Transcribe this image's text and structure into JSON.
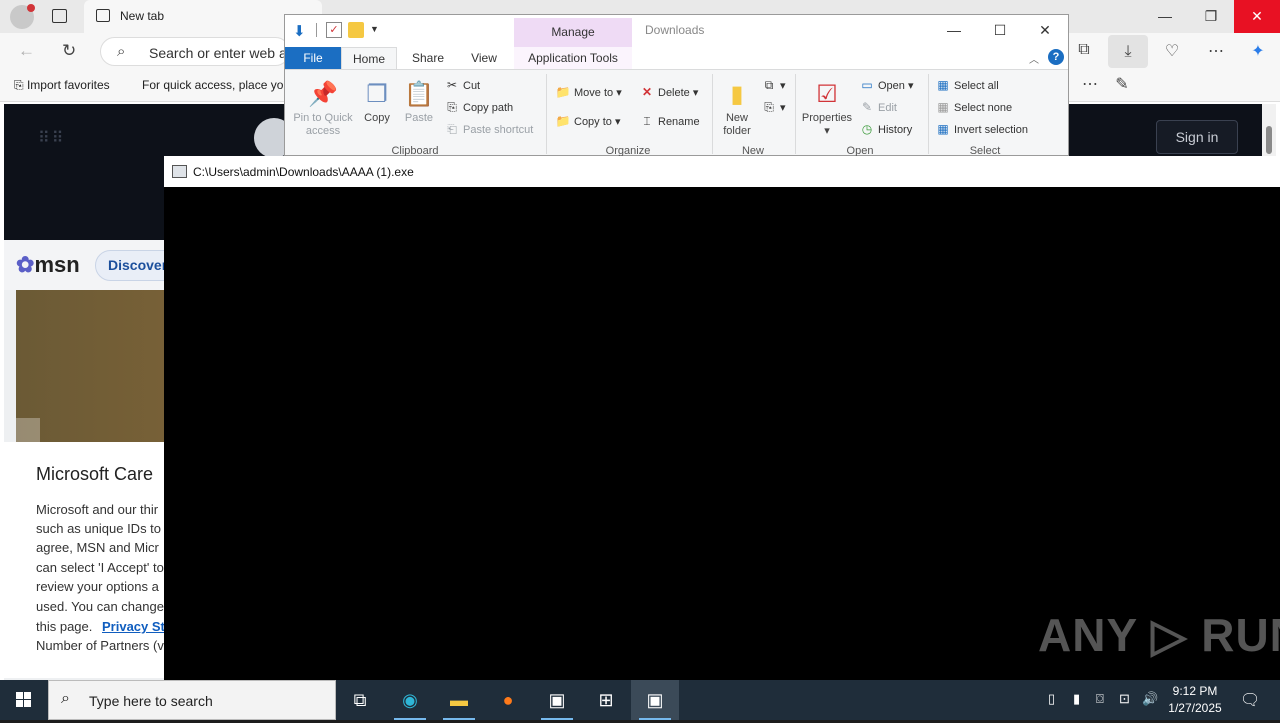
{
  "browser": {
    "tab_title": "New tab",
    "address_placeholder": "Search or enter web a",
    "favorites": {
      "import_label": "Import favorites",
      "quick_access_text": "For quick access, place you"
    },
    "signin_label": "Sign in",
    "msn": {
      "logo": "msn",
      "discover_label": "Discover",
      "consent_title": "Microsoft Care",
      "consent_lines": [
        "Microsoft and our thir",
        "such as unique IDs to",
        "agree, MSN and Micr",
        "can select 'I Accept' to",
        "review your options a",
        "used. You can change",
        "this page."
      ],
      "privacy_link": "Privacy Sta",
      "partners_text": "Number of Partners (v"
    }
  },
  "explorer": {
    "title": "Downloads",
    "contextual_tab": "Manage",
    "tabs": [
      "File",
      "Home",
      "Share",
      "View",
      "Application Tools"
    ],
    "ribbon": {
      "clipboard": {
        "label": "Clipboard",
        "pin": "Pin to Quick access",
        "copy": "Copy",
        "paste": "Paste",
        "cut": "Cut",
        "copy_path": "Copy path",
        "paste_shortcut": "Paste shortcut"
      },
      "organize": {
        "label": "Organize",
        "move_to": "Move to",
        "copy_to": "Copy to",
        "delete": "Delete",
        "rename": "Rename"
      },
      "new": {
        "label": "New",
        "new_folder": "New folder"
      },
      "open": {
        "label": "Open",
        "properties": "Properties",
        "open": "Open",
        "edit": "Edit",
        "history": "History"
      },
      "select": {
        "label": "Select",
        "select_all": "Select all",
        "select_none": "Select none",
        "invert": "Invert selection"
      }
    }
  },
  "console": {
    "title": "C:\\Users\\admin\\Downloads\\AAAA (1).exe",
    "watermark": "ANY ▷ RUN"
  },
  "taskbar": {
    "search_placeholder": "Type here to search",
    "time": "9:12 PM",
    "date": "1/27/2025"
  },
  "colors": {
    "file_tab": "#1b6ec2",
    "manage_band": "#efdbf5",
    "taskbar": "#1f2d3a",
    "close_red": "#e81123"
  }
}
